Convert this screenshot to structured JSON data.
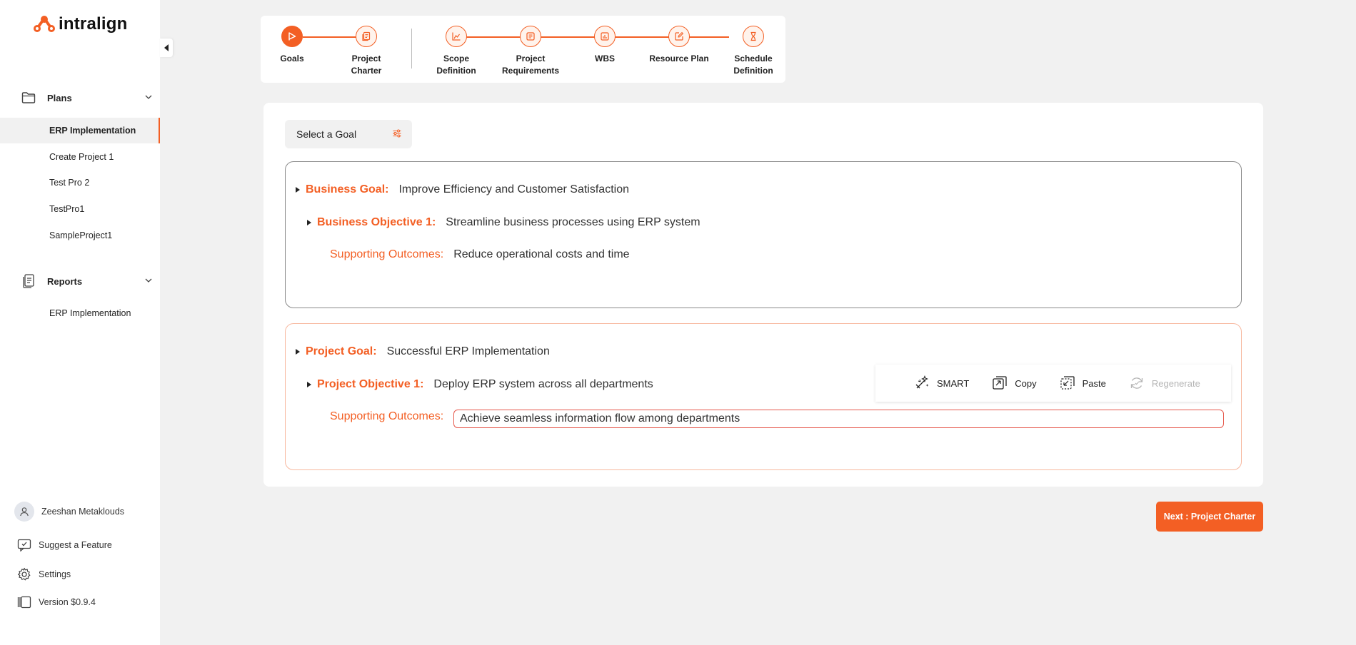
{
  "app": {
    "name": "intralign",
    "accent": "#f35f24"
  },
  "sidebar": {
    "sections": [
      {
        "label": "Plans",
        "icon": "folder-icon",
        "items": [
          {
            "label": "ERP Implementation",
            "active": true
          },
          {
            "label": "Create Project 1"
          },
          {
            "label": "Test Pro 2"
          },
          {
            "label": "TestPro1"
          },
          {
            "label": "SampleProject1"
          }
        ]
      },
      {
        "label": "Reports",
        "icon": "report-icon",
        "items": [
          {
            "label": "ERP Implementation"
          }
        ]
      }
    ],
    "bottom": {
      "user": "Zeeshan Metaklouds",
      "suggest": "Suggest a Feature",
      "settings": "Settings",
      "version": "Version $0.9.4"
    }
  },
  "stepper": {
    "steps": [
      {
        "label1": "Goals",
        "label2": "",
        "icon": "flag-icon",
        "active": true
      },
      {
        "label1": "Project",
        "label2": "Charter",
        "icon": "document-icon"
      },
      {
        "label1": "Scope",
        "label2": "Definition",
        "icon": "chart-icon"
      },
      {
        "label1": "Project",
        "label2": "Requirements",
        "icon": "list-icon"
      },
      {
        "label1": "WBS",
        "label2": "",
        "icon": "bar-chart-icon"
      },
      {
        "label1": "Resource Plan",
        "label2": "",
        "icon": "edit-icon"
      },
      {
        "label1": "Schedule",
        "label2": "Definition",
        "icon": "hourglass-icon"
      }
    ]
  },
  "main": {
    "goal_select": "Select a Goal",
    "business": {
      "goal_key": "Business Goal:",
      "goal_value": "Improve Efficiency and Customer Satisfaction",
      "objective_key": "Business Objective 1:",
      "objective_value": "Streamline business processes using ERP system",
      "outcomes_key": "Supporting Outcomes:",
      "outcomes_value": "Reduce operational costs and time"
    },
    "project": {
      "goal_key": "Project Goal:",
      "goal_value": "Successful ERP Implementation",
      "objective_key": "Project Objective 1:",
      "objective_value": "Deploy ERP system across all departments",
      "outcomes_key": "Supporting Outcomes:",
      "outcomes_value": "Achieve seamless information flow among departments"
    },
    "toolbar": {
      "smart": "SMART",
      "copy": "Copy",
      "paste": "Paste",
      "regenerate": "Regenerate"
    },
    "next_button": "Next : Project Charter"
  }
}
